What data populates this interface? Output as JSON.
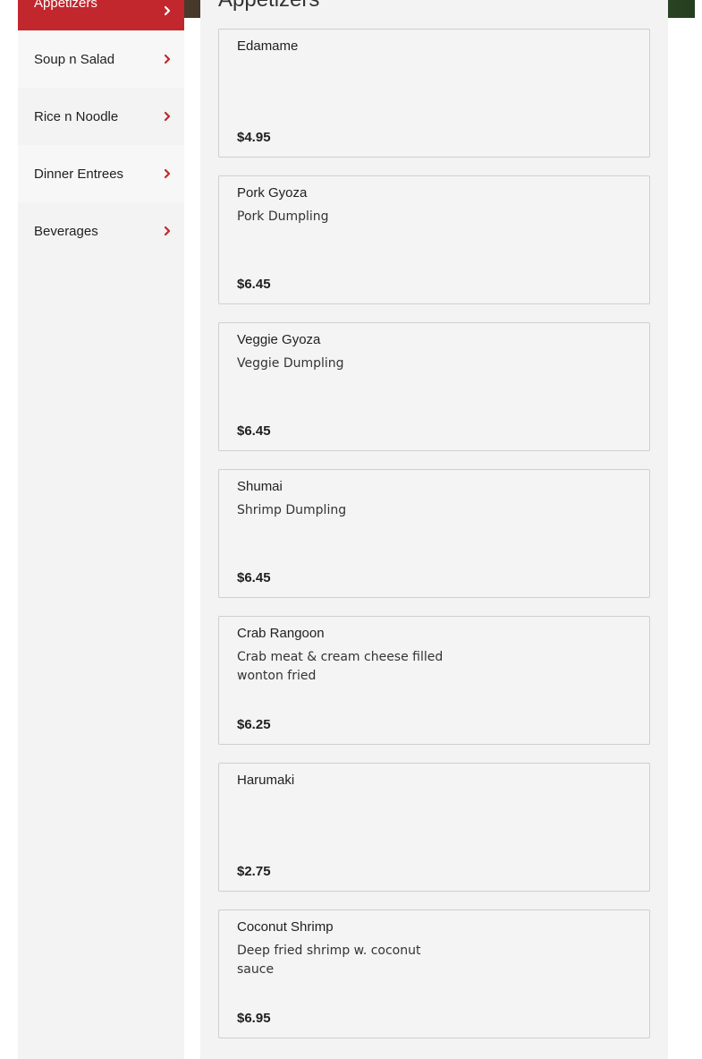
{
  "sidebar": {
    "items": [
      {
        "label": "Appetizers"
      },
      {
        "label": "Soup n Salad"
      },
      {
        "label": "Rice n Noodle"
      },
      {
        "label": "Dinner Entrees"
      },
      {
        "label": "Beverages"
      }
    ]
  },
  "colors": {
    "accent": "#c1272d",
    "panel": "#f3f3f3"
  },
  "main": {
    "title": "Appetizers",
    "items": [
      {
        "name": "Edamame",
        "desc": "",
        "price": "$4.95"
      },
      {
        "name": "Pork Gyoza",
        "desc": "Pork Dumpling",
        "price": "$6.45"
      },
      {
        "name": "Veggie Gyoza",
        "desc": "Veggie Dumpling",
        "price": "$6.45"
      },
      {
        "name": "Shumai",
        "desc": "Shrimp Dumpling",
        "price": "$6.45"
      },
      {
        "name": "Crab Rangoon",
        "desc": "Crab meat & cream cheese filled wonton fried",
        "price": "$6.25"
      },
      {
        "name": "Harumaki",
        "desc": "",
        "price": "$2.75"
      },
      {
        "name": "Coconut Shrimp",
        "desc": "Deep fried shrimp w. coconut sauce",
        "price": "$6.95"
      }
    ]
  }
}
